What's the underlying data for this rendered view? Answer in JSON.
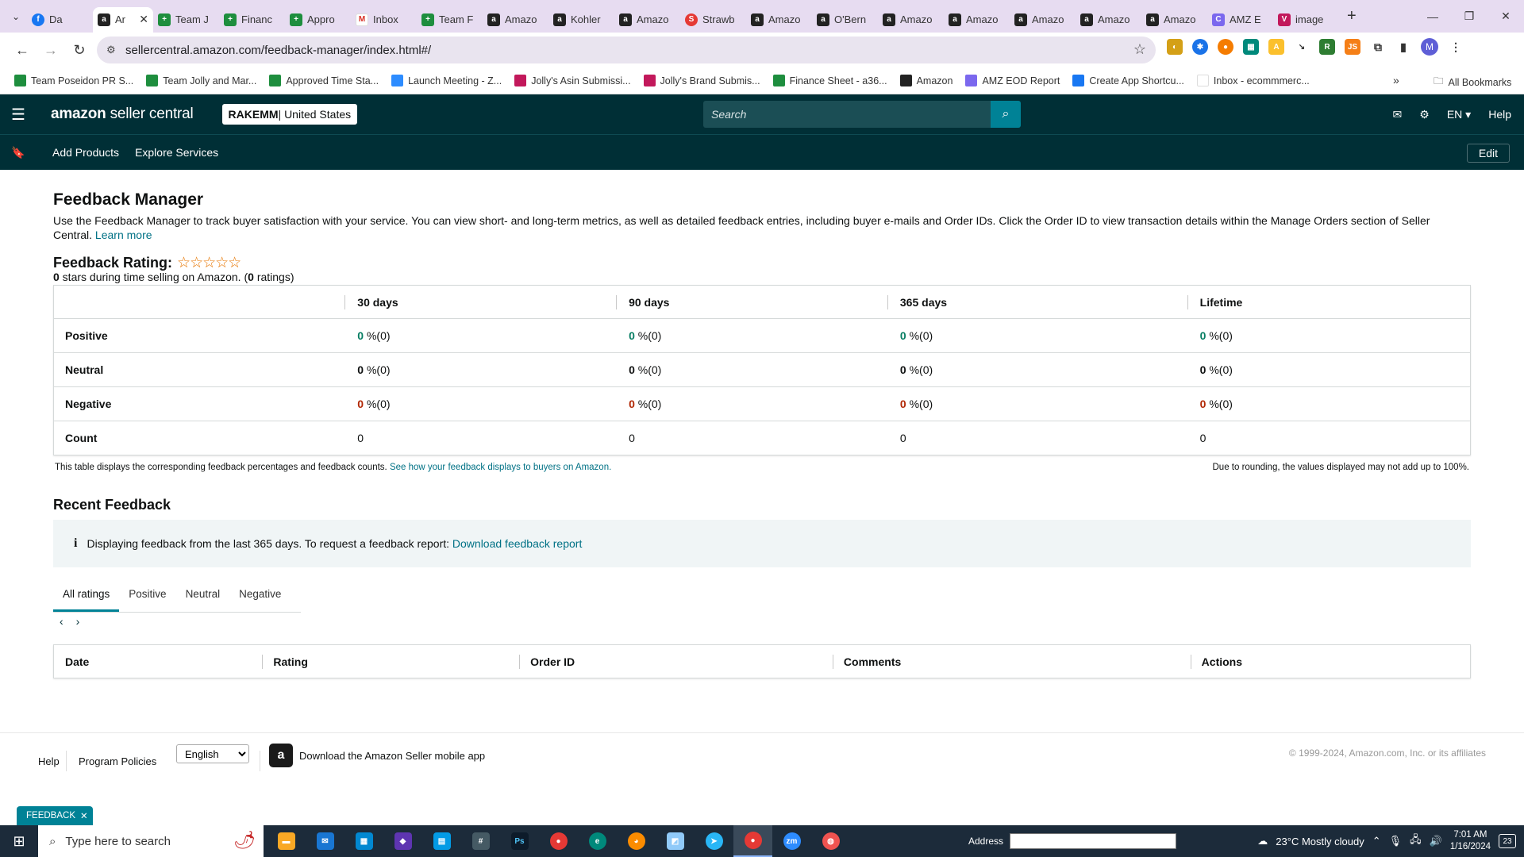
{
  "browser": {
    "tabs": [
      {
        "label": "Da",
        "icon": "fb",
        "mark": "f"
      },
      {
        "label": "Ar",
        "icon": "amz",
        "mark": "a",
        "active": true
      },
      {
        "label": "Team J",
        "icon": "sheet",
        "mark": "+"
      },
      {
        "label": "Financ",
        "icon": "sheet",
        "mark": "+"
      },
      {
        "label": "Appro",
        "icon": "sheet",
        "mark": "+"
      },
      {
        "label": "Inbox",
        "icon": "gm",
        "mark": "M"
      },
      {
        "label": "Team F",
        "icon": "sheet",
        "mark": "+"
      },
      {
        "label": "Amazo",
        "icon": "amz",
        "mark": "a"
      },
      {
        "label": "Kohler",
        "icon": "amz",
        "mark": "a"
      },
      {
        "label": "Amazo",
        "icon": "amz",
        "mark": "a"
      },
      {
        "label": "Strawb",
        "icon": "strw",
        "mark": "S"
      },
      {
        "label": "Amazo",
        "icon": "amz",
        "mark": "a"
      },
      {
        "label": "O'Bern",
        "icon": "amz",
        "mark": "a"
      },
      {
        "label": "Amazo",
        "icon": "amz",
        "mark": "a"
      },
      {
        "label": "Amazo",
        "icon": "amz",
        "mark": "a"
      },
      {
        "label": "Amazo",
        "icon": "amz",
        "mark": "a"
      },
      {
        "label": "Amazo",
        "icon": "amz",
        "mark": "a"
      },
      {
        "label": "Amazo",
        "icon": "amz",
        "mark": "a"
      },
      {
        "label": "AMZ E",
        "icon": "clk",
        "mark": "C"
      },
      {
        "label": "image",
        "icon": "pink",
        "mark": "V"
      }
    ],
    "url": "sellercentral.amazon.com/feedback-manager/index.html#/",
    "profile_initial": "M",
    "bookmarks": [
      {
        "label": "Team Poseidon PR S...",
        "icon": "sheet"
      },
      {
        "label": "Team Jolly and Mar...",
        "icon": "sheet"
      },
      {
        "label": "Approved Time Sta...",
        "icon": "sheet"
      },
      {
        "label": "Launch Meeting - Z...",
        "icon": "zm"
      },
      {
        "label": "Jolly's Asin Submissi...",
        "icon": "pink"
      },
      {
        "label": "Jolly's Brand Submis...",
        "icon": "pink"
      },
      {
        "label": "Finance Sheet - a36...",
        "icon": "sheet"
      },
      {
        "label": "Amazon",
        "icon": "amz"
      },
      {
        "label": "AMZ EOD Report",
        "icon": "clk"
      },
      {
        "label": "Create App Shortcu...",
        "icon": "fb"
      },
      {
        "label": "Inbox - ecommmerc...",
        "icon": "gm"
      }
    ],
    "all_bookmarks": "All Bookmarks"
  },
  "header": {
    "logo_brand": "amazon",
    "logo_rest": " seller central",
    "store_name": "RAKEMM",
    "store_region": " | United States",
    "search_placeholder": "Search",
    "lang": "EN",
    "help": "Help"
  },
  "subnav": {
    "items": [
      "Add Products",
      "Explore Services"
    ],
    "edit": "Edit"
  },
  "page": {
    "title": "Feedback Manager",
    "intro": "Use the Feedback Manager to track buyer satisfaction with your service. You can view short- and long-term metrics, as well as detailed feedback entries, including buyer e-mails and Order IDs. Click the Order ID to view transaction details within the Manage Orders section of Seller Central.",
    "learn_more": "Learn more",
    "rating_title": "Feedback Rating:",
    "stars": "☆☆☆☆☆",
    "rating_sub_pre": " stars during time selling on Amazon. (",
    "rating_stars_value": "0",
    "rating_count": "0",
    "rating_sub_post": " ratings)"
  },
  "metrics": {
    "columns": [
      "30 days",
      "90 days",
      "365 days",
      "Lifetime"
    ],
    "rows": [
      {
        "label": "Positive",
        "tone": "g",
        "cells": [
          {
            "v": "0",
            "s": " %(0)"
          },
          {
            "v": "0",
            "s": " %(0)"
          },
          {
            "v": "0",
            "s": " %(0)"
          },
          {
            "v": "0",
            "s": " %(0)"
          }
        ]
      },
      {
        "label": "Neutral",
        "tone": "n",
        "cells": [
          {
            "v": "0",
            "s": " %(0)"
          },
          {
            "v": "0",
            "s": " %(0)"
          },
          {
            "v": "0",
            "s": " %(0)"
          },
          {
            "v": "0",
            "s": " %(0)"
          }
        ]
      },
      {
        "label": "Negative",
        "tone": "r",
        "cells": [
          {
            "v": "0",
            "s": " %(0)"
          },
          {
            "v": "0",
            "s": " %(0)"
          },
          {
            "v": "0",
            "s": " %(0)"
          },
          {
            "v": "0",
            "s": " %(0)"
          }
        ]
      }
    ],
    "count_label": "Count",
    "counts": [
      "0",
      "0",
      "0",
      "0"
    ],
    "note": "This table displays the corresponding feedback percentages and feedback counts. ",
    "note_link": "See how your feedback displays to buyers on Amazon.",
    "rounding_note": "Due to rounding, the values displayed may not add up to 100%."
  },
  "recent": {
    "title": "Recent Feedback",
    "alert_text": "Displaying feedback from the last 365 days. To request a feedback report: ",
    "alert_link": "Download feedback report",
    "tabs": [
      "All ratings",
      "Positive",
      "Neutral",
      "Negative"
    ],
    "active_tab": 0,
    "columns": [
      "Date",
      "Rating",
      "Order ID",
      "Comments",
      "Actions"
    ]
  },
  "footer": {
    "help": "Help",
    "policies": "Program Policies",
    "language": "English",
    "app_text": "Download the Amazon Seller mobile app",
    "copyright": "© 1999-2024, Amazon.com, Inc. or its affiliates",
    "feedback_tag": "FEEDBACK"
  },
  "taskbar": {
    "search_placeholder": "Type here to search",
    "address_label": "Address",
    "weather": "23°C  Mostly cloudy",
    "time": "7:01 AM",
    "date": "1/16/2024",
    "notifications": "23"
  },
  "colors": {
    "header": "#002f36",
    "accent": "#008296",
    "link": "#007185",
    "positive": "#067d62",
    "negative": "#b12704"
  }
}
